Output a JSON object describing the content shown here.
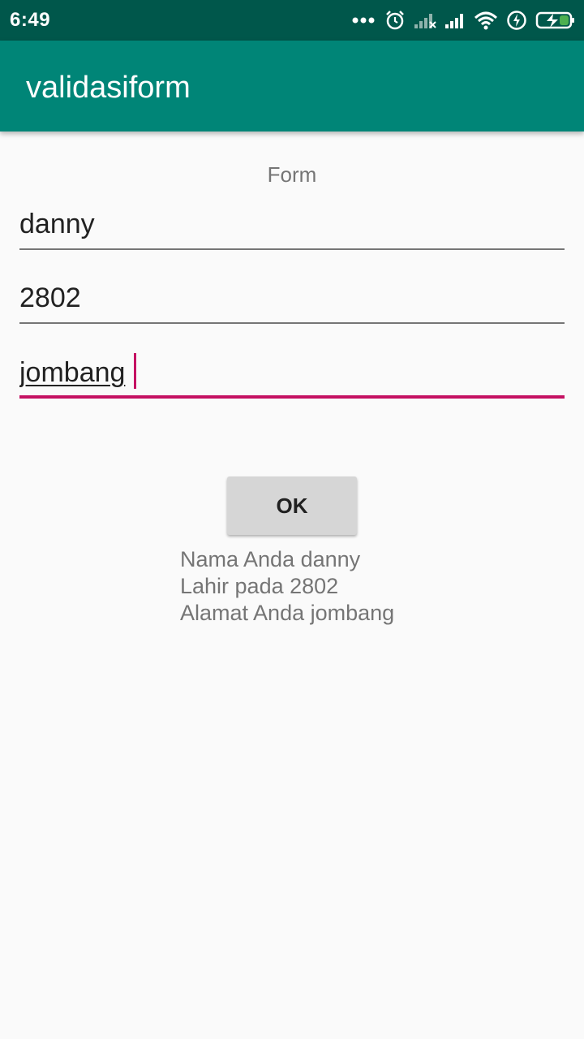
{
  "status_bar": {
    "time": "6:49",
    "icons": [
      "more-dots-icon",
      "alarm-icon",
      "signal-no-service-icon",
      "signal-icon",
      "wifi-icon",
      "data-saver-icon",
      "battery-charging-icon"
    ]
  },
  "app_bar": {
    "title": "validasiform"
  },
  "form": {
    "label": "Form",
    "fields": [
      {
        "value": "danny"
      },
      {
        "value": "2802"
      },
      {
        "value": "jombang"
      }
    ],
    "ok_label": "OK"
  },
  "result": {
    "lines": [
      "Nama Anda danny",
      "Lahir pada 2802",
      "Alamat Anda jombang"
    ]
  },
  "colors": {
    "status_bar": "#00574b",
    "app_bar": "#008577",
    "accent": "#c51162",
    "background": "#fafafa"
  }
}
